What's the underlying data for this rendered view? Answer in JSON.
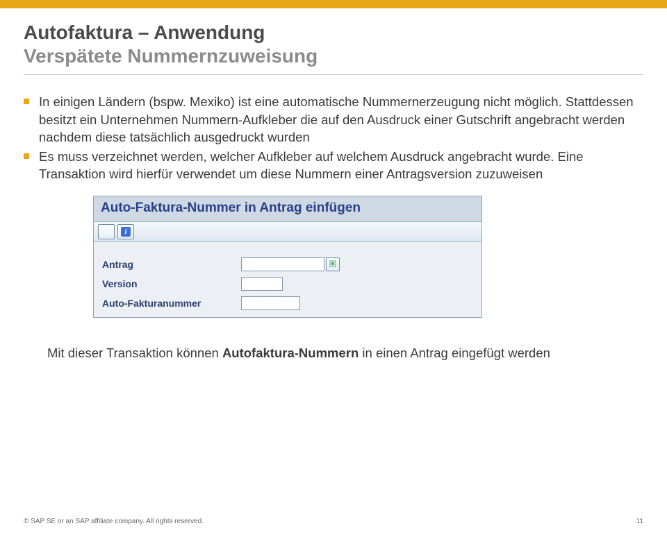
{
  "header": {
    "title": "Autofaktura – Anwendung",
    "subtitle": "Verspätete Nummernzuweisung"
  },
  "bullets": {
    "b1": "In einigen Ländern (bspw. Mexiko) ist eine automatische Nummernerzeugung nicht möglich. Stattdessen besitzt ein Unternehmen Nummern-Aufkleber die auf den Ausdruck einer Gutschrift angebracht werden nachdem diese tatsächlich ausgedruckt wurden",
    "b2": "Es muss verzeichnet werden, welcher Aufkleber auf welchem Ausdruck angebracht wurde. Eine Transaktion wird hierfür verwendet um diese Nummern einer Antragsversion zuzuweisen"
  },
  "sap": {
    "title": "Auto-Faktura-Nummer in Antrag einfügen",
    "toolbar": {
      "exec_icon": "clock-check-icon",
      "info_icon": "info-icon"
    },
    "rows": {
      "antrag": {
        "label": "Antrag",
        "value": ""
      },
      "version": {
        "label": "Version",
        "value": ""
      },
      "afnr": {
        "label": "Auto-Fakturanummer",
        "value": ""
      }
    }
  },
  "bottom_note_pre": "Mit dieser Transaktion können ",
  "bottom_note_bold": "Autofaktura-Nummern",
  "bottom_note_post": " in einen Antrag eingefügt werden",
  "footer": {
    "copyright": "SAP SE or an SAP affiliate company. All rights reserved.",
    "page": "11"
  }
}
